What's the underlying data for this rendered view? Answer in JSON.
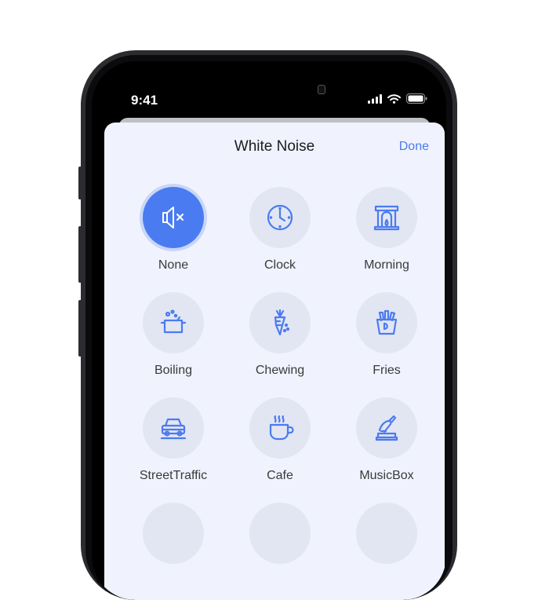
{
  "status_bar": {
    "time": "9:41"
  },
  "sheet": {
    "title": "White Noise",
    "done_label": "Done",
    "accent_color": "#4b7bf0"
  },
  "sounds": [
    {
      "label": "None",
      "icon": "mute-speaker-icon",
      "selected": true
    },
    {
      "label": "Clock",
      "icon": "clock-icon",
      "selected": false
    },
    {
      "label": "Morning",
      "icon": "fireplace-icon",
      "selected": false
    },
    {
      "label": "Boiling",
      "icon": "boiling-pot-icon",
      "selected": false
    },
    {
      "label": "Chewing",
      "icon": "carrot-icon",
      "selected": false
    },
    {
      "label": "Fries",
      "icon": "fries-icon",
      "selected": false
    },
    {
      "label": "StreetTraffic",
      "icon": "car-icon",
      "selected": false
    },
    {
      "label": "Cafe",
      "icon": "coffee-cup-icon",
      "selected": false
    },
    {
      "label": "MusicBox",
      "icon": "music-box-icon",
      "selected": false
    }
  ]
}
